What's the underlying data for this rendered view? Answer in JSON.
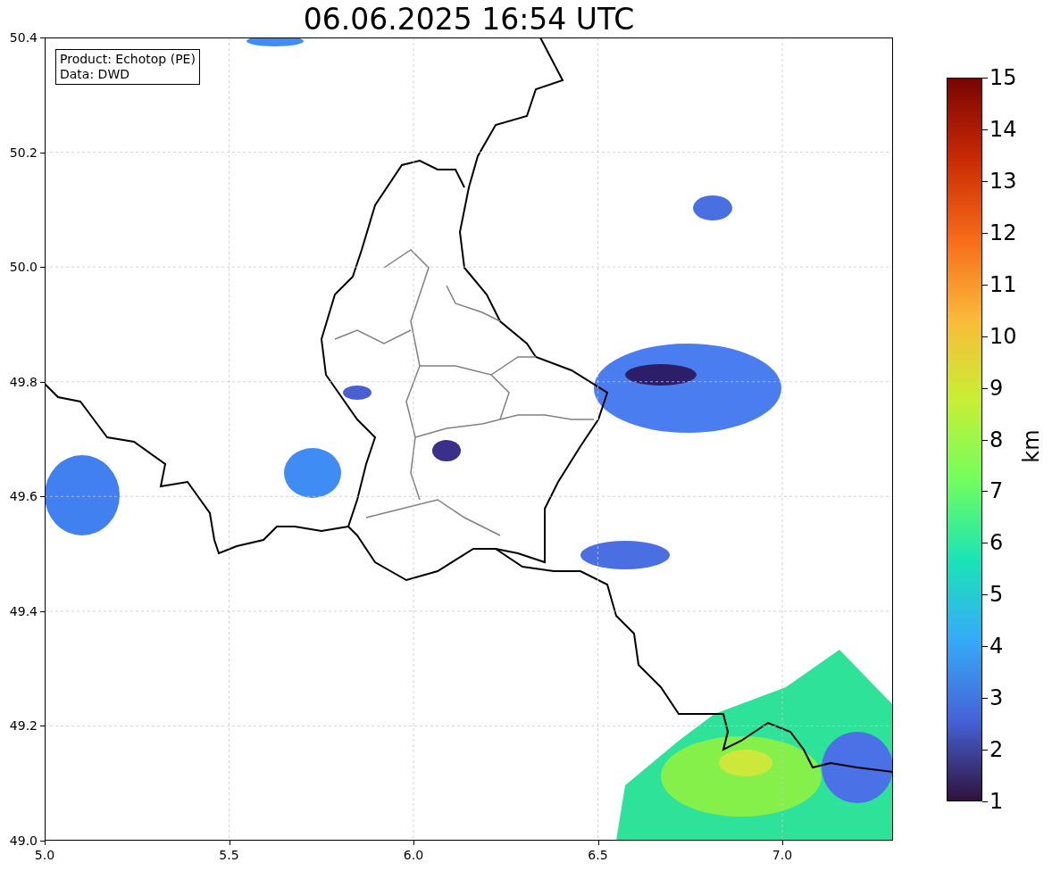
{
  "title": "06.06.2025 16:54 UTC",
  "legend_box": [
    "Product: Echotop (PE)",
    "Data: DWD"
  ],
  "x_ticks": [
    "5.0",
    "5.5",
    "6.0",
    "6.5",
    "7.0"
  ],
  "y_ticks": [
    "50.4",
    "50.2",
    "50.0",
    "49.8",
    "49.6",
    "49.4",
    "49.2",
    "49.0"
  ],
  "colorbar": {
    "label": "km",
    "ticks": [
      "15",
      "14",
      "13",
      "12",
      "11",
      "10",
      "9",
      "8",
      "7",
      "6",
      "5",
      "4",
      "3",
      "2",
      "1"
    ]
  }
}
